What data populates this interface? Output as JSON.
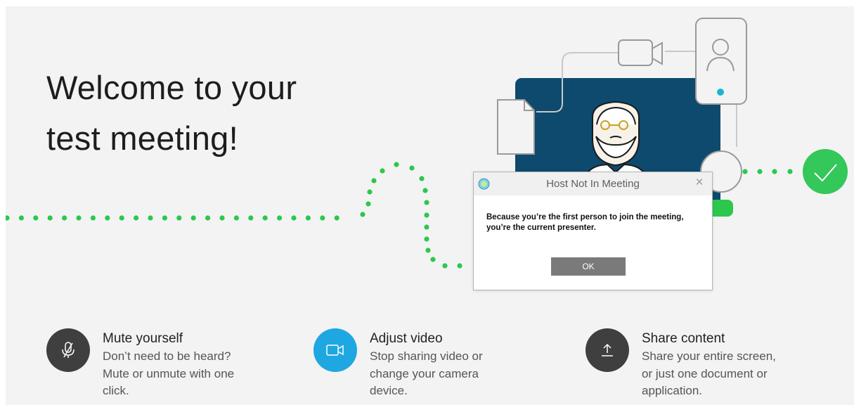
{
  "welcome": {
    "line1": "Welcome to your",
    "line2": "test meeting!"
  },
  "tips": [
    {
      "icon": "microphone-muted-icon",
      "title": "Mute yourself",
      "lines": [
        "Don’t need to be heard?",
        "Mute or unmute with one",
        "click."
      ],
      "circle_color": "#3f3f3f"
    },
    {
      "icon": "video-camera-icon",
      "title": "Adjust video",
      "lines": [
        "Stop sharing video or",
        "change your camera",
        "device."
      ],
      "circle_color": "#1ea7e1"
    },
    {
      "icon": "share-upload-icon",
      "title": "Share content",
      "lines": [
        "Share your entire screen,",
        "or just one document or",
        "application."
      ],
      "circle_color": "#3f3f3f"
    }
  ],
  "dialog": {
    "title": "Host Not In Meeting",
    "message_line1": "Because you’re the first person to join the meeting,",
    "message_line2": "you’re the current presenter.",
    "ok_label": "OK",
    "close_glyph": "×",
    "app_icon": "webex-app-icon",
    "close_icon": "close-icon"
  },
  "colors": {
    "background": "#f3f3f3",
    "dots_green": "#2bc84c",
    "check_green": "#34c759",
    "video_blue": "#1ea7e1",
    "screen_navy": "#0d4a6e",
    "tip_dark": "#3f3f3f"
  }
}
